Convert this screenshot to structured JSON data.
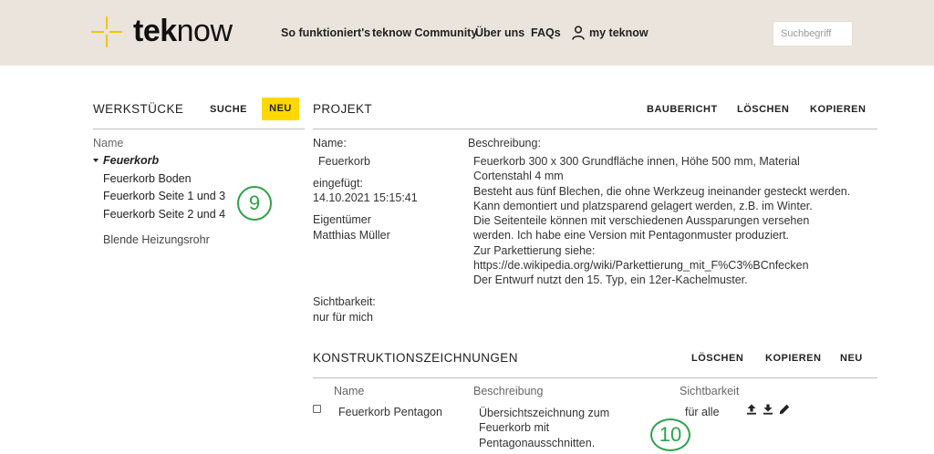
{
  "header": {
    "brand_bold": "tek",
    "brand_light": "now",
    "nav": {
      "how": "So funktioniert's",
      "community": "teknow Community",
      "about": "Über uns",
      "faqs": "FAQs",
      "my": "my teknow"
    },
    "search_placeholder": "Suchbegriff"
  },
  "werkstuecke": {
    "title": "WERKSTÜCKE",
    "search_label": "SUCHE",
    "new_label": "NEU",
    "column_name": "Name",
    "root_item": "Feuerkorb",
    "children": [
      "Feuerkorb Boden",
      "Feuerkorb Seite 1 und 3",
      "Feuerkorb Seite 2 und 4"
    ],
    "other_item": "Blende Heizungsrohr"
  },
  "projekt": {
    "title": "PROJEKT",
    "actions": {
      "report": "BAUBERICHT",
      "delete": "LÖSCHEN",
      "copy": "KOPIEREN"
    },
    "name_label": "Name:",
    "name_value": "Feuerkorb",
    "inserted_label": "eingefügt:",
    "inserted_value": "14.10.2021 15:15:41",
    "owner_label": "Eigentümer",
    "owner_value": "Matthias Müller",
    "visibility_label": "Sichtbarkeit:",
    "visibility_value": "nur für mich",
    "description_label": "Beschreibung:",
    "description_lines": [
      "Feuerkorb 300 x 300 Grundfläche innen, Höhe 500 mm, Material",
      "Cortenstahl 4 mm",
      "Besteht aus fünf Blechen, die ohne Werkzeug ineinander gesteckt werden.",
      "Kann demontiert und platzsparend gelagert werden, z.B. im Winter.",
      "Die Seitenteile können mit verschiedenen Aussparungen versehen",
      "werden. Ich habe eine Version mit Pentagonmuster produziert.",
      "Zur Parkettierung siehe:",
      "https://de.wikipedia.org/wiki/Parkettierung_mit_F%C3%BCnfecken",
      "Der Entwurf nutzt den 15. Typ, ein 12er-Kachelmuster."
    ]
  },
  "konstruktion": {
    "title": "KONSTRUKTIONSZEICHNUNGEN",
    "actions": {
      "delete": "LÖSCHEN",
      "copy": "KOPIEREN",
      "new": "NEU"
    },
    "columns": {
      "name": "Name",
      "description": "Beschreibung",
      "visibility": "Sichtbarkeit"
    },
    "rows": [
      {
        "name": "Feuerkorb Pentagon",
        "description_lines": [
          "Übersichtszeichnung zum",
          "Feuerkorb mit",
          "Pentagonausschnitten."
        ],
        "visibility": "für alle",
        "icons": [
          "upload-icon",
          "download-icon",
          "edit-pencil-icon"
        ]
      }
    ]
  },
  "annotations": {
    "badge_left": "9",
    "badge_right": "10",
    "color": "#2ca24a"
  },
  "colors": {
    "header_bg": "#ebe4dc",
    "accent_yellow": "#ffd800",
    "logo_yellow": "#f5c400"
  }
}
